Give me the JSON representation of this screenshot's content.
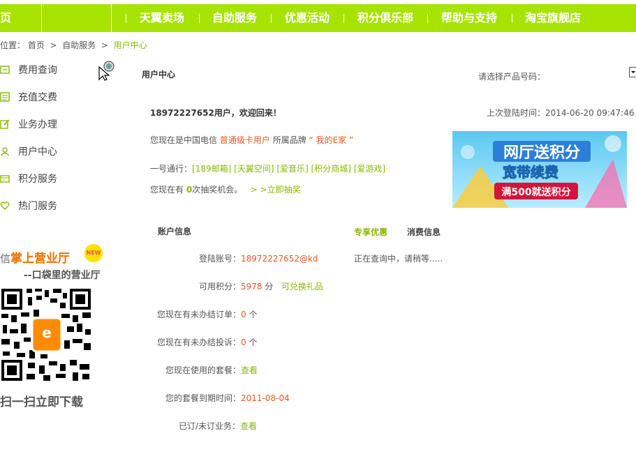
{
  "nav": {
    "items": [
      "页",
      "天翼卖场",
      "自助服务",
      "优惠活动",
      "积分俱乐部",
      "帮助与支持",
      "淘宝旗舰店"
    ]
  },
  "breadcrumb": {
    "prefix": "位置：",
    "home": "首页",
    "sep": ">",
    "section": "自助服务",
    "current": "用户中心"
  },
  "sidebar": {
    "items": [
      {
        "label": "费用查询",
        "icon": "bill-icon"
      },
      {
        "label": "充值交费",
        "icon": "card-icon"
      },
      {
        "label": "业务办理",
        "icon": "edit-icon"
      },
      {
        "label": "用户中心",
        "icon": "user-icon"
      },
      {
        "label": "积分服务",
        "icon": "points-icon"
      },
      {
        "label": "热门服务",
        "icon": "heart-icon"
      }
    ]
  },
  "promo": {
    "title_pre": "信",
    "title": "掌上营业厅",
    "badge": "NEW",
    "subtitle": "--口袋里的营业厅",
    "scan": "扫一扫立即下载"
  },
  "main": {
    "heading": "用户中心",
    "product_label": "请选择产品号码：",
    "welcome": "18972227652用户，欢迎回来！",
    "last_login_label": "上次登陆时间：",
    "last_login": "2014-06-20 09:47:46",
    "status_pre": "您现在是中国电信",
    "status_type": "普通级卡用户",
    "status_mid": "所属品牌",
    "brand": "“ 我的E家 ”",
    "pass_label": "一号通行：",
    "pass_links": [
      "[189邮箱]",
      "[天翼空间]",
      "[爱音乐]",
      "[积分商城]",
      "[爱游戏]"
    ],
    "lottery_pre": "您现在有",
    "lottery_count": "0",
    "lottery_post": "次抽奖机会。",
    "lottery_link": "> >立即抽奖"
  },
  "banner": {
    "line1": "网厅送积分",
    "line2": "宽带续费",
    "line3": "满500就送积分"
  },
  "account": {
    "tab_account": "账户信息",
    "tab_offers": "专享优惠",
    "tab_consume": "消费信息",
    "querying": "正在查询中，请稍等.....",
    "rows": [
      {
        "label": "登陆账号：",
        "value": "18972227652@kd"
      },
      {
        "label": "可用积分：",
        "value": "5978",
        "unit": "分",
        "link": "可兑换礼品"
      },
      {
        "label": "您现在有未办结订单：",
        "value": "0",
        "unit": "个"
      },
      {
        "label": "您现在有未办结投诉：",
        "value": "0",
        "unit": "个"
      },
      {
        "label": "您现在使用的套餐：",
        "link": "查看"
      },
      {
        "label": "您的套餐到期时间：",
        "value": "2011-08-04"
      },
      {
        "label": "已订/未订业务：",
        "link": "查看"
      }
    ]
  },
  "colors": {
    "brand_green": "#a6e400",
    "accent_orange": "#e8581e",
    "link_green": "#8ab800"
  }
}
